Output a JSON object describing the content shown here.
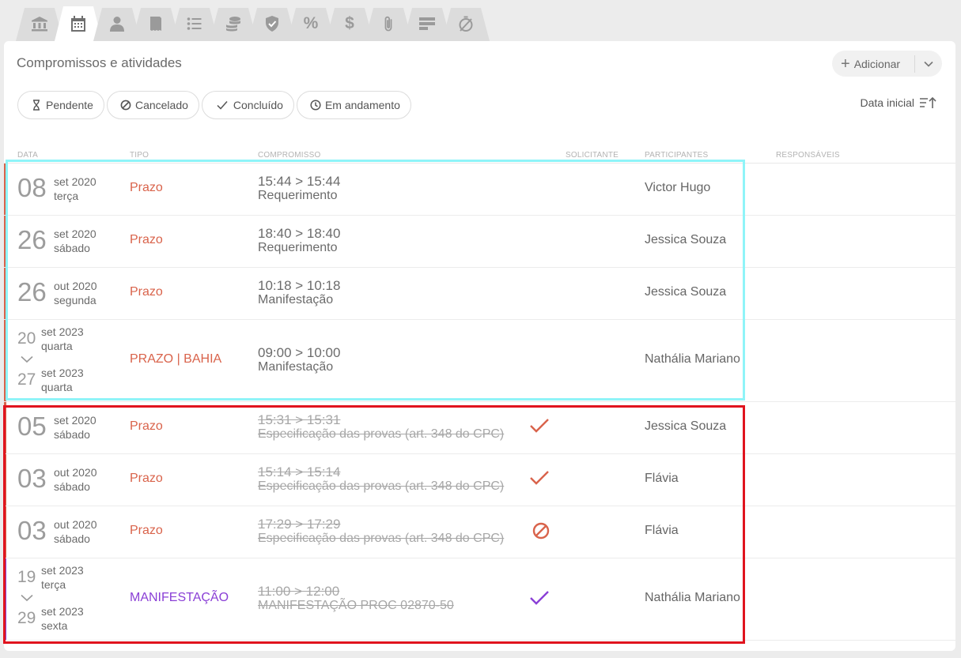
{
  "tabs": [
    {
      "name": "bank-icon"
    },
    {
      "name": "calendar-icon"
    },
    {
      "name": "person-icon"
    },
    {
      "name": "document-icon"
    },
    {
      "name": "list-icon"
    },
    {
      "name": "coins-icon"
    },
    {
      "name": "shield-icon"
    },
    {
      "name": "percent-icon",
      "glyph": "%"
    },
    {
      "name": "dollar-icon",
      "glyph": "$"
    },
    {
      "name": "paperclip-icon"
    },
    {
      "name": "bars-icon"
    },
    {
      "name": "timer-off-icon"
    }
  ],
  "header": {
    "title": "Compromissos e atividades",
    "add_label": "Adicionar"
  },
  "filters": {
    "pendente": "Pendente",
    "cancelado": "Cancelado",
    "concluido": "Concluído",
    "em_andamento": "Em andamento"
  },
  "sort": {
    "label": "Data inicial"
  },
  "columns": {
    "data": "DATA",
    "tipo": "TIPO",
    "compromisso": "COMPROMISSO",
    "solicitante": "SOLICITANTE",
    "participantes": "PARTICIPANTES",
    "responsaveis": "RESPONSÁVEIS"
  },
  "rows": [
    {
      "day": "08",
      "month": "set 2020",
      "weekday": "terça",
      "type": "Prazo",
      "time": "15:44 > 15:44",
      "desc": "Requerimento",
      "participant": "Victor Hugo"
    },
    {
      "day": "26",
      "month": "set 2020",
      "weekday": "sábado",
      "type": "Prazo",
      "time": "18:40 > 18:40",
      "desc": "Requerimento",
      "participant": "Jessica Souza"
    },
    {
      "day": "26",
      "month": "out 2020",
      "weekday": "segunda",
      "type": "Prazo",
      "time": "10:18 > 10:18",
      "desc": "Manifestação",
      "participant": "Jessica Souza"
    },
    {
      "day1": "20",
      "month1": "set 2023",
      "weekday1": "quarta",
      "day2": "27",
      "month2": "set 2023",
      "weekday2": "quarta",
      "type": "PRAZO | BAHIA",
      "time": "09:00 > 10:00",
      "desc": "Manifestação",
      "participant": "Nathália Mariano"
    },
    {
      "day": "05",
      "month": "set 2020",
      "weekday": "sábado",
      "type": "Prazo",
      "time": "15:31 > 15:31",
      "desc": "Especificação das provas (art. 348 do CPC)",
      "participant": "Jessica Souza",
      "status": "concluded"
    },
    {
      "day": "03",
      "month": "out 2020",
      "weekday": "sábado",
      "type": "Prazo",
      "time": "15:14 > 15:14",
      "desc": "Especificação das provas (art. 348 do CPC)",
      "participant": "Flávia",
      "status": "concluded"
    },
    {
      "day": "03",
      "month": "out 2020",
      "weekday": "sábado",
      "type": "Prazo",
      "time": "17:29 > 17:29",
      "desc": "Especificação das provas (art. 348 do CPC)",
      "participant": "Flávia",
      "status": "cancelled"
    },
    {
      "day1": "19",
      "month1": "set 2023",
      "weekday1": "terça",
      "day2": "29",
      "month2": "set 2023",
      "weekday2": "sexta",
      "type": "MANIFESTAÇÃO",
      "time": "11:00 > 12:00",
      "desc": "MANIFESTAÇÃO PROC 02870-50",
      "participant": "Nathália Mariano",
      "status": "concluded"
    }
  ],
  "colors": {
    "prazo": "#d9634b",
    "manifestacao": "#8a3fd6",
    "highlight_cyan": "#8ff4f8",
    "highlight_red": "#e0141e"
  }
}
